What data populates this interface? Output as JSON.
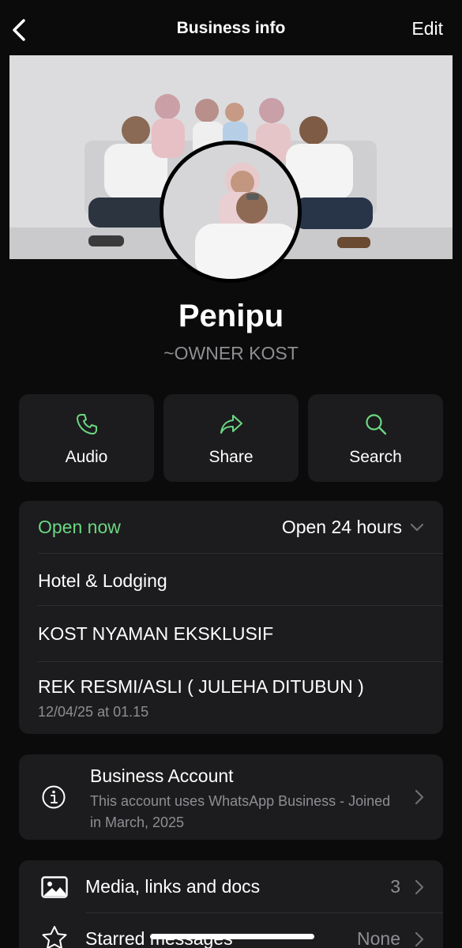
{
  "header": {
    "title": "Business info",
    "back_icon": "chevron-left-icon",
    "edit_label": "Edit"
  },
  "profile": {
    "name": "Penipu",
    "subtitle": "~OWNER KOST"
  },
  "actions": [
    {
      "label": "Audio",
      "icon": "phone-icon"
    },
    {
      "label": "Share",
      "icon": "share-arrow-icon"
    },
    {
      "label": "Search",
      "icon": "search-icon"
    }
  ],
  "business_info": {
    "status": "Open now",
    "hours": "Open 24 hours",
    "category": "Hotel & Lodging",
    "description": "KOST NYAMAN EKSKLUSIF",
    "note": "REK RESMI/ASLI ( JULEHA DITUBUN )",
    "note_time": "12/04/25 at 01.15"
  },
  "business_account": {
    "title": "Business Account",
    "description": "This account uses WhatsApp Business - Joined in March, 2025"
  },
  "media": {
    "label": "Media, links and docs",
    "count": "3"
  },
  "starred": {
    "label": "Starred messages",
    "value": "None"
  },
  "colors": {
    "accent_green": "#6bd782",
    "background": "#0b0b0b",
    "card": "#1c1c1e",
    "secondary_text": "#8e8e93"
  }
}
